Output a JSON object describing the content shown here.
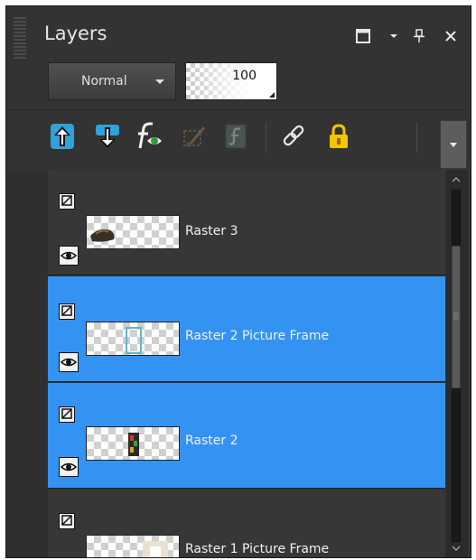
{
  "panel": {
    "title": "Layers",
    "window_buttons": [
      "restore-icon",
      "menu-arrow-icon",
      "pin-icon",
      "close-icon"
    ]
  },
  "blend_mode": {
    "value": "Normal"
  },
  "opacity": {
    "value": "100"
  },
  "toolbar": {
    "icons": [
      "move-layer-up-icon",
      "move-layer-down-icon",
      "layer-effects-icon",
      "edit-selection-icon",
      "script-icon",
      "link-icon",
      "lock-icon",
      "more-icon"
    ]
  },
  "layers": [
    {
      "name": "Raster 3",
      "selected": false
    },
    {
      "name": "Raster 2 Picture Frame",
      "selected": true
    },
    {
      "name": "Raster 2",
      "selected": true
    },
    {
      "name": "Raster 1 Picture Frame",
      "selected": false
    }
  ],
  "colors": {
    "panel_bg": "#333333",
    "selection": "#3493f2",
    "accent_icon": "#2fa2d9",
    "lock_icon": "#f5c400"
  }
}
